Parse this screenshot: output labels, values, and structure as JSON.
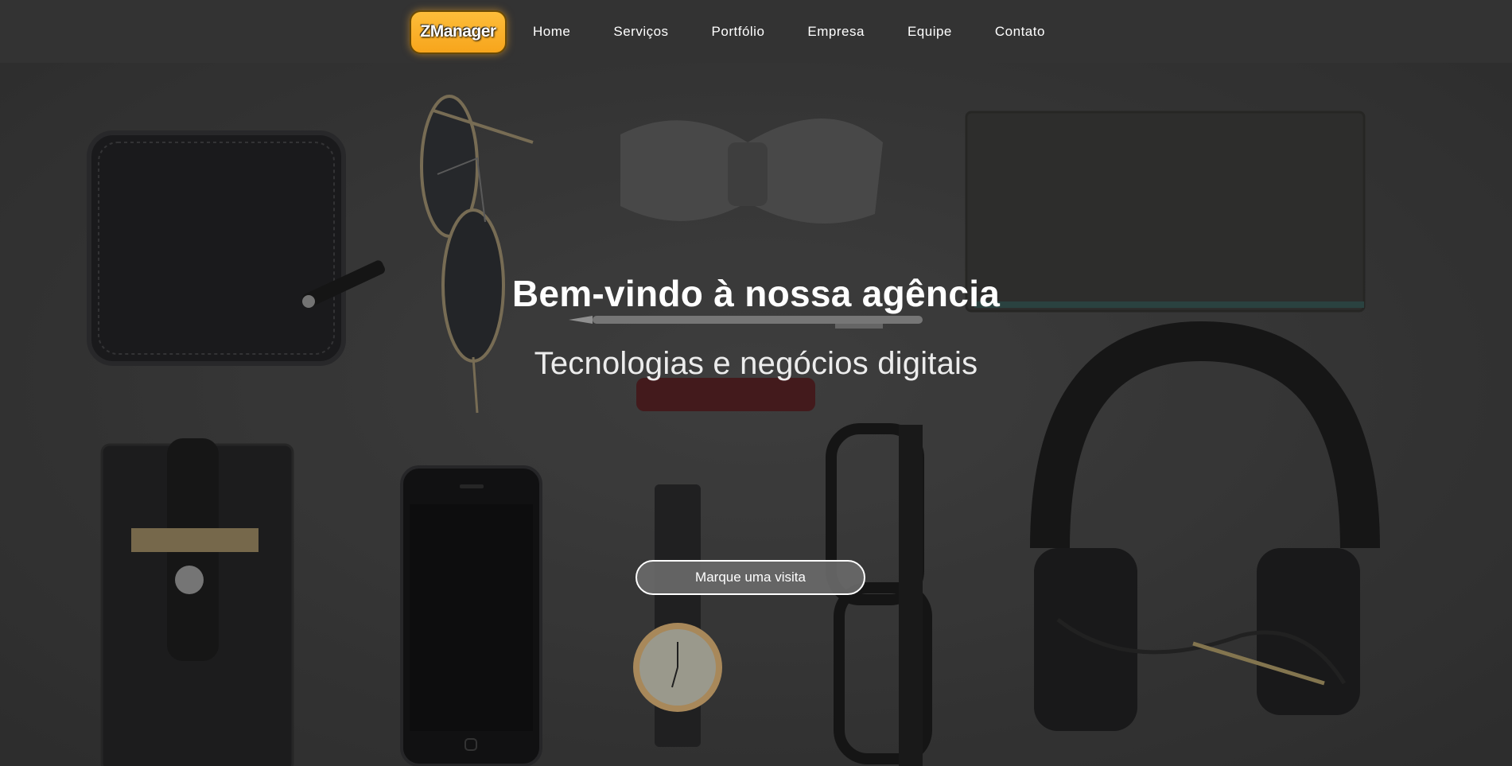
{
  "navbar": {
    "brand": "ZManager",
    "links": [
      {
        "label": "Home"
      },
      {
        "label": "Serviços"
      },
      {
        "label": "Portfólio"
      },
      {
        "label": "Empresa"
      },
      {
        "label": "Equipe"
      },
      {
        "label": "Contato"
      }
    ]
  },
  "hero": {
    "title": "Bem-vindo à nossa agência",
    "subtitle": "Tecnologias e negócios digitais",
    "cta_label": "Marque uma visita"
  },
  "colors": {
    "navbar_bg": "#333333",
    "brand_accent": "#fbb02b",
    "cta_bg": "#696969"
  }
}
